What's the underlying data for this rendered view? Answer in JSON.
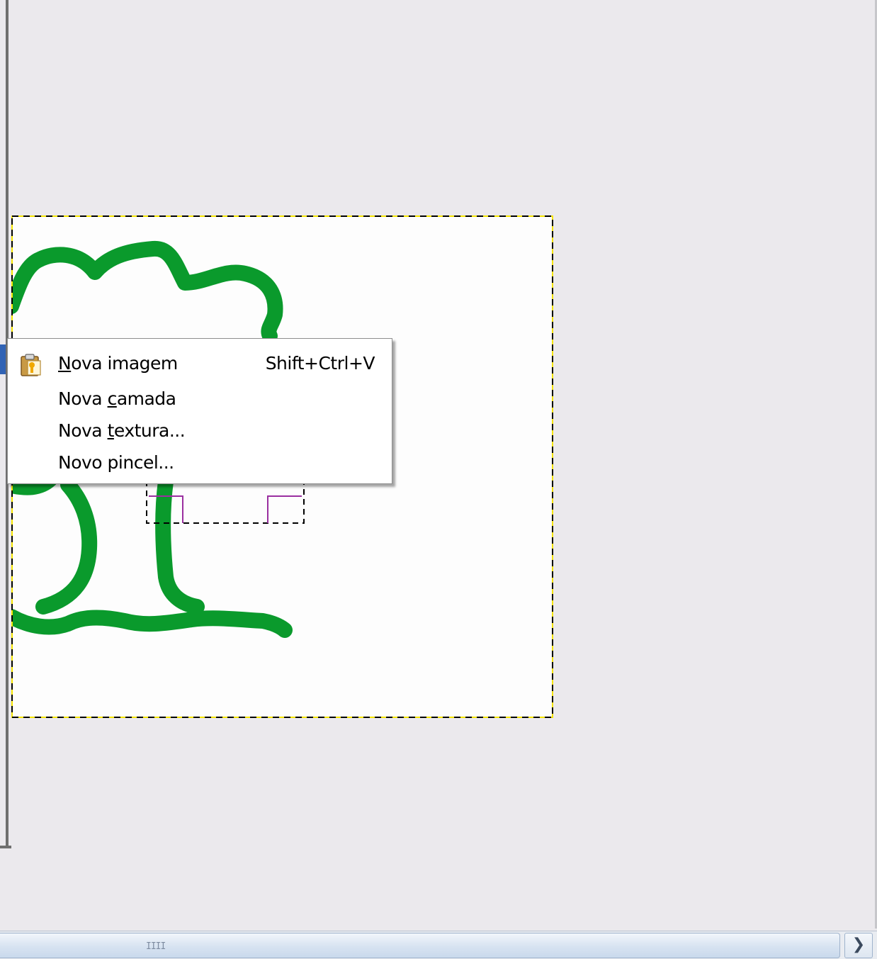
{
  "context_menu": {
    "items": [
      {
        "pre": "",
        "mnemonic": "N",
        "post": "ova imagem",
        "shortcut": "Shift+Ctrl+V",
        "icon": "paste-as-new-icon"
      },
      {
        "pre": "Nova ",
        "mnemonic": "c",
        "post": "amada",
        "shortcut": ""
      },
      {
        "pre": "Nova ",
        "mnemonic": "t",
        "post": "extura...",
        "shortcut": ""
      },
      {
        "pre": "Novo pincel...",
        "mnemonic": "",
        "post": "",
        "shortcut": ""
      }
    ]
  },
  "scrollbar": {
    "grip": "IIII",
    "right_arrow": "❯"
  },
  "colors": {
    "workspace_bg": "#ebe9ed",
    "canvas_bg": "#fdfdfd",
    "stroke_green": "#0a9a2c",
    "selection_magenta": "#9a2fa0",
    "accent_blue": "#3163b5"
  }
}
